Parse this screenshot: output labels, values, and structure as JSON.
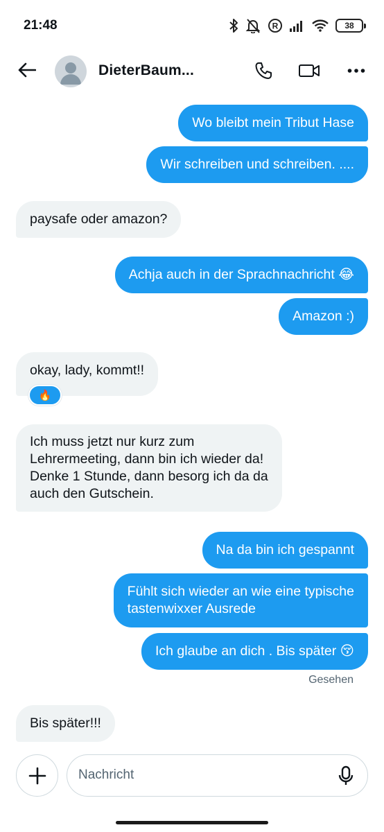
{
  "status_bar": {
    "time": "21:48",
    "icons": [
      "bluetooth-icon",
      "bell-muted-icon",
      "registered-icon",
      "signal-icon",
      "wifi-icon",
      "battery-icon"
    ],
    "battery": "38"
  },
  "header": {
    "contact_name": "DieterBaum...",
    "icons": [
      "back-arrow-icon",
      "phone-icon",
      "video-icon",
      "more-icon"
    ]
  },
  "messages": [
    {
      "direction": "out",
      "text": "Wo bleibt mein Tribut Hase"
    },
    {
      "direction": "out",
      "text": "Wir schreiben und schreiben. ...."
    },
    {
      "direction": "in",
      "text": "paysafe oder amazon?"
    },
    {
      "direction": "out",
      "text": "Achja auch in der Sprachnachricht 😂"
    },
    {
      "direction": "out",
      "text": "Amazon :)"
    },
    {
      "direction": "in",
      "text": "okay, lady, kommt!!",
      "reaction": "🔥"
    },
    {
      "direction": "in",
      "lines": [
        "Ich muss jetzt nur kurz zum",
        "Lehrermeeting, dann bin ich wieder da!",
        "Denke 1 Stunde, dann besorg ich da da",
        "auch den Gutschein."
      ]
    },
    {
      "direction": "out",
      "text": "Na da bin ich gespannt"
    },
    {
      "direction": "out",
      "lines": [
        "Fühlt sich wieder an wie eine typische",
        "tastenwixxer Ausrede"
      ]
    },
    {
      "direction": "out",
      "text": "Ich glaube an dich . Bis später 😚"
    },
    {
      "direction": "in",
      "text": "Bis später!!!"
    }
  ],
  "seen_label": "Gesehen",
  "composer": {
    "placeholder": "Nachricht",
    "value": ""
  },
  "colors": {
    "accent": "#1d9bf0",
    "incoming_bubble": "#eff3f4",
    "text": "#0f1419",
    "muted": "#536471"
  }
}
